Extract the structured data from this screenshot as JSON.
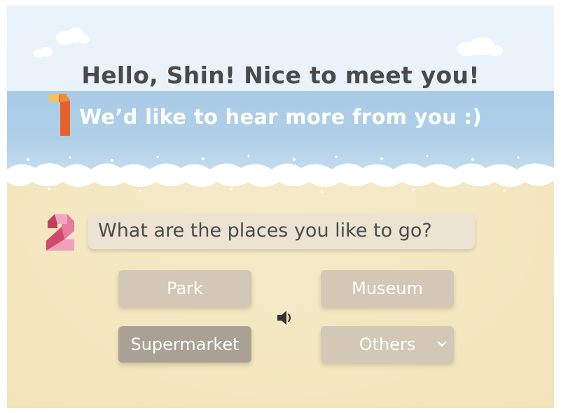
{
  "greeting": "Hello, Shin! Nice to meet you!",
  "intro": "We’d like to hear more from you :)",
  "question": "What are the places you like to go?",
  "options": [
    "Park",
    "Museum",
    "Supermarket",
    "Others"
  ],
  "selected_option": "Supermarket",
  "icons": {
    "step_one": "number-one-icon",
    "step_two": "number-two-icon",
    "sound": "speaker-icon",
    "dropdown": "chevron-down-icon"
  },
  "colors": {
    "option_default": "#d3c8b5",
    "option_selected": "#a9a193",
    "question_bg": "#ece3d3",
    "title_text": "#4a4a4a"
  }
}
